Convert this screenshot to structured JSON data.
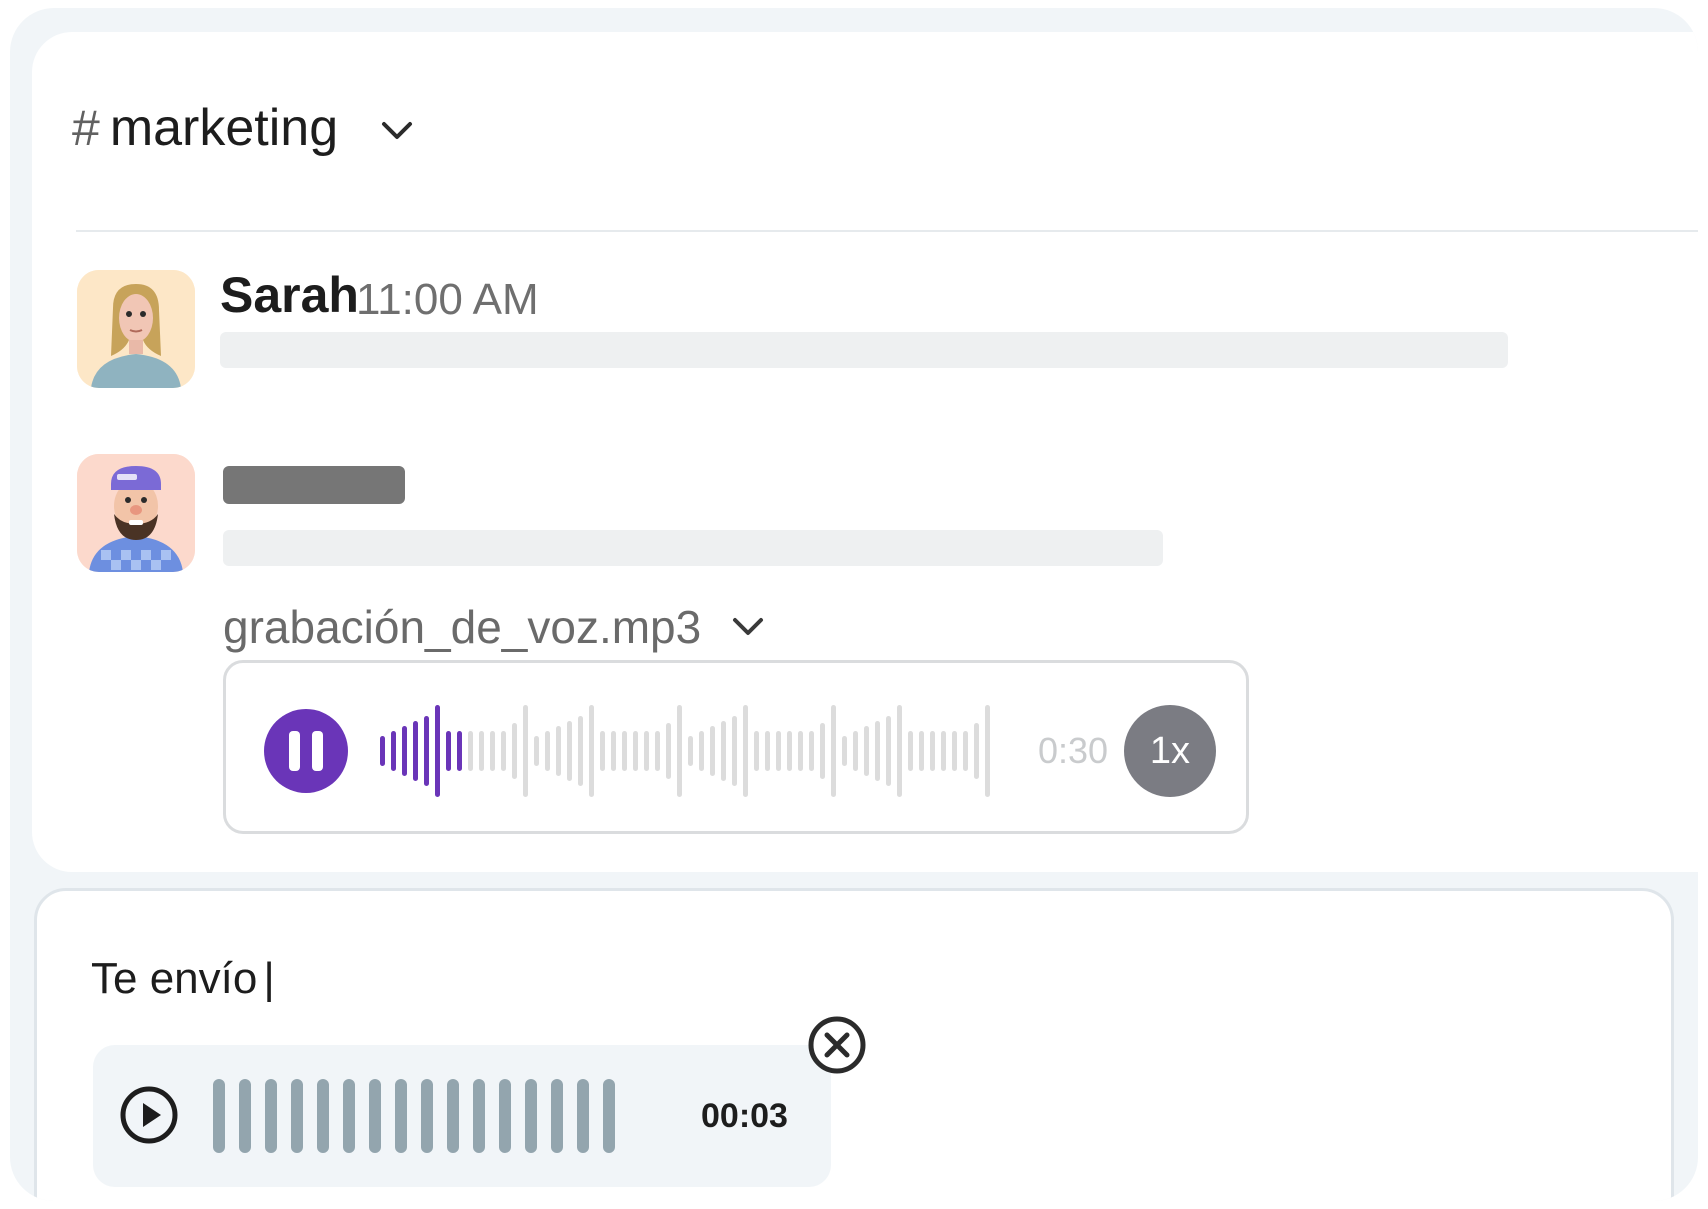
{
  "channel": {
    "hash": "#",
    "name": "marketing"
  },
  "messages": [
    {
      "author": "Sarah",
      "time": "11:00 AM"
    },
    {
      "author": ""
    }
  ],
  "attachment_message": {
    "file_name": "grabación_de_voz.mp3",
    "duration": "0:30",
    "speed": "1x",
    "accent_color": "#6a35b8"
  },
  "composer": {
    "text": "Te envío",
    "caret": "|",
    "attachment": {
      "time": "00:03"
    }
  }
}
